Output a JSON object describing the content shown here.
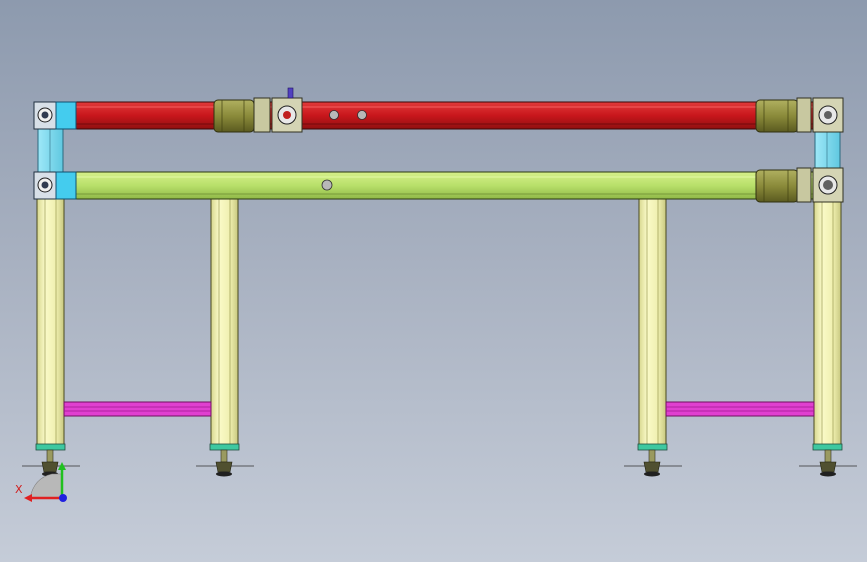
{
  "viewport": {
    "background_top": "#8d9aae",
    "background_bottom": "#c5ccd8"
  },
  "colors": {
    "upper_rail": "#c8161c",
    "lower_rail": "#b8e06a",
    "legs": "#f0f0b0",
    "crossbar": "#e040d0",
    "end_block": "#44ccee",
    "motor": "#8a8a3a",
    "gearbox": "#c8c8a0"
  },
  "triad": {
    "x_label": "X",
    "x_axis_color": "#e02020",
    "y_axis_color": "#20c020",
    "z_axis_color": "#2020e0"
  }
}
